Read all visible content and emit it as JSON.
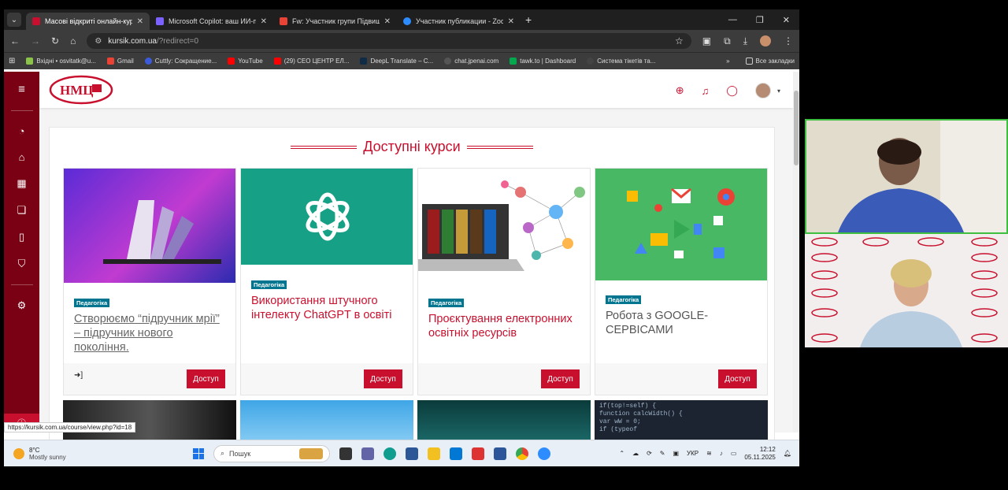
{
  "browser": {
    "tabs": [
      {
        "title": "Масові відкриті онлайн-курси",
        "active": true,
        "color": "#c8102e"
      },
      {
        "title": "Microsoft Copilot: ваш ИИ-пом",
        "active": false,
        "color": "#7b61ff"
      },
      {
        "title": "Fw: Участник групи Підвищен",
        "active": false,
        "color": "#ea4335"
      },
      {
        "title": "Участник публикации - Zoom",
        "active": false,
        "color": "#2d8cff"
      }
    ],
    "url_host": "kursik.com.ua",
    "url_path": "/?redirect=0",
    "bookmarks": [
      {
        "label": "Вхідні • osvitatk@u...",
        "color": "#8bc34a"
      },
      {
        "label": "Gmail",
        "color": "#ea4335"
      },
      {
        "label": "Cuttly: Сокращение...",
        "color": "#3b5bdb"
      },
      {
        "label": "YouTube",
        "color": "#ff0000"
      },
      {
        "label": "(29) СЕО ЦЕНТР ЕЛ...",
        "color": "#ff0000"
      },
      {
        "label": "DeepL Translate – C...",
        "color": "#0f2b46"
      },
      {
        "label": "chat.jpenai.com",
        "color": "#555555"
      },
      {
        "label": "tawk.to | Dashboard",
        "color": "#03a84e"
      },
      {
        "label": "Система тікетів та...",
        "color": "#444444"
      }
    ],
    "all_bookmarks": "Все закладки"
  },
  "site": {
    "logo_text": "НМЦ",
    "section_title": "Доступні курси",
    "courses": [
      {
        "category": "Педагогіка",
        "title": "Створюємо “підручник мрії” – підручник нового покоління.",
        "button": "Доступ"
      },
      {
        "category": "Педагогіка",
        "title": "Використання штучного інтелекту ChatGPT в освіті",
        "button": "Доступ"
      },
      {
        "category": "Педагогіка",
        "title": "Проєктування електронних освітніх ресурсів",
        "button": "Доступ"
      },
      {
        "category": "Педагогіка",
        "title": "Робота з GOOGLE-СЕРВІСАМИ",
        "button": "Доступ"
      }
    ],
    "status_url": "https://kursik.com.ua/course/view.php?id=18",
    "code_snippet": [
      "if(top!=self) {",
      "function calcWidth() {",
      " var wW = 0;",
      " if (typeof"
    ]
  },
  "taskbar": {
    "temp": "8°C",
    "weather": "Mostly sunny",
    "search_placeholder": "Пошук",
    "lang": "УКР",
    "time": "12:12",
    "date": "05.11.2025"
  },
  "colors": {
    "brand": "#c8102e",
    "sidebar": "#7a0013",
    "category": "#00758f"
  }
}
